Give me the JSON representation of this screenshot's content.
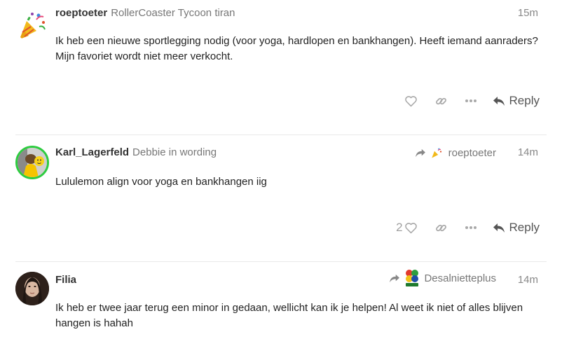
{
  "posts": [
    {
      "username": "roeptoeter",
      "user_title": "RollerCoaster Tycoon tiran",
      "time": "15m",
      "avatar_icon": "party-popper",
      "body": "Ik heb een nieuwe sportlegging nodig (voor yoga, hardlopen en bankhangen). Heeft iemand aanraders? Mijn favoriet wordt niet meer verkocht.",
      "reply_label": "Reply"
    },
    {
      "username": "Karl_Lagerfeld",
      "user_title": "Debbie in wording",
      "time": "14m",
      "avatar_icon": "photo-yellow-hat",
      "avatar_ring_color": "#2ecc40",
      "reply_to": {
        "username": "roeptoeter",
        "icon": "party-popper"
      },
      "body": "Lululemon align voor yoga en bankhangen iig",
      "like_count": "2",
      "reply_label": "Reply"
    },
    {
      "username": "Filia",
      "user_title": "",
      "time": "14m",
      "avatar_icon": "photo-portrait",
      "reply_to": {
        "username": "Desalnietteplus",
        "icon": "four-leaf-clover-logo"
      },
      "body": "Ik heb er twee jaar terug een minor in gedaan, wellicht kan ik je helpen! Al weet ik niet of alles blijven hangen is hahah"
    }
  ],
  "colors": {
    "username": "#333333",
    "muted": "#777777",
    "action_icon": "#a8a8a8",
    "divider": "#e9e9e9"
  }
}
